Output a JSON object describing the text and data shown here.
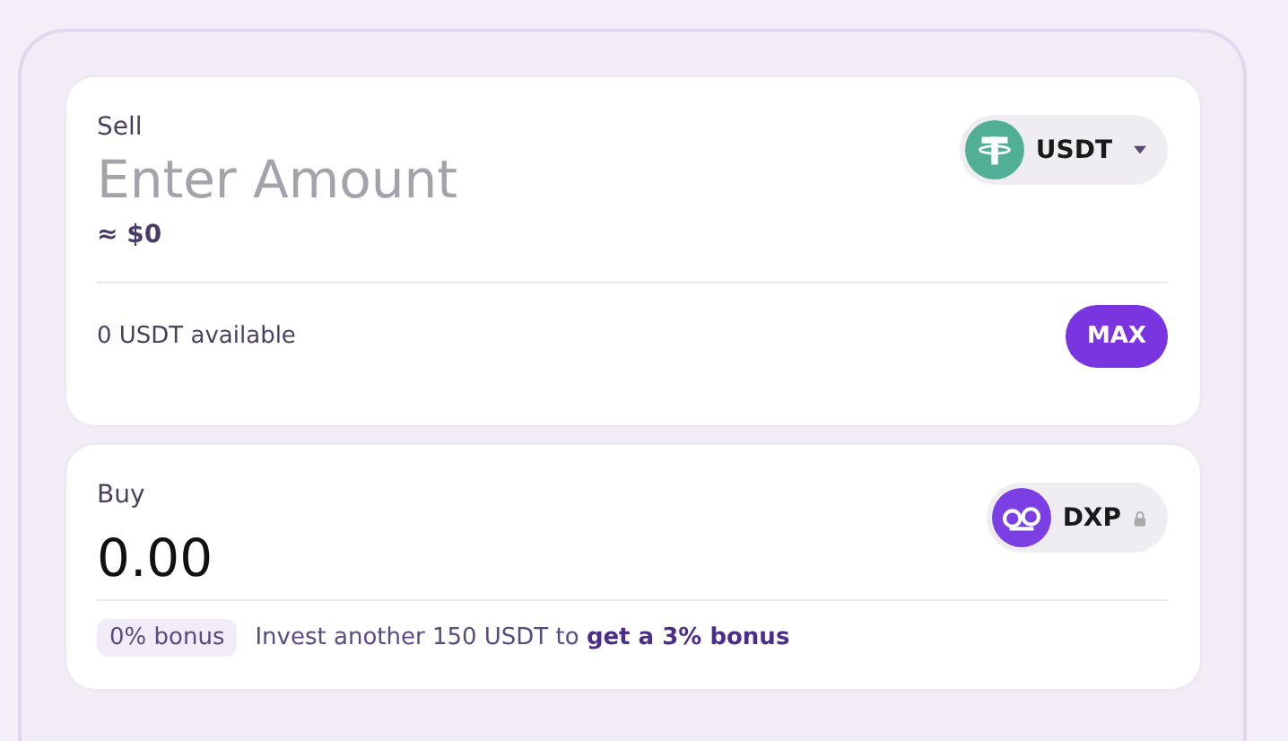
{
  "sell": {
    "label": "Sell",
    "placeholder": "Enter Amount",
    "usd": "≈ $0",
    "token": {
      "symbol": "USDT",
      "kind": "dropdown"
    },
    "available": "0 USDT available",
    "max_button": "MAX"
  },
  "buy": {
    "label": "Buy",
    "value": "0.00",
    "token": {
      "symbol": "DXP",
      "kind": "locked"
    },
    "bonus_badge": "0% bonus",
    "bonus_text": "Invest another 150 USDT to **get a 3% bonus**"
  }
}
